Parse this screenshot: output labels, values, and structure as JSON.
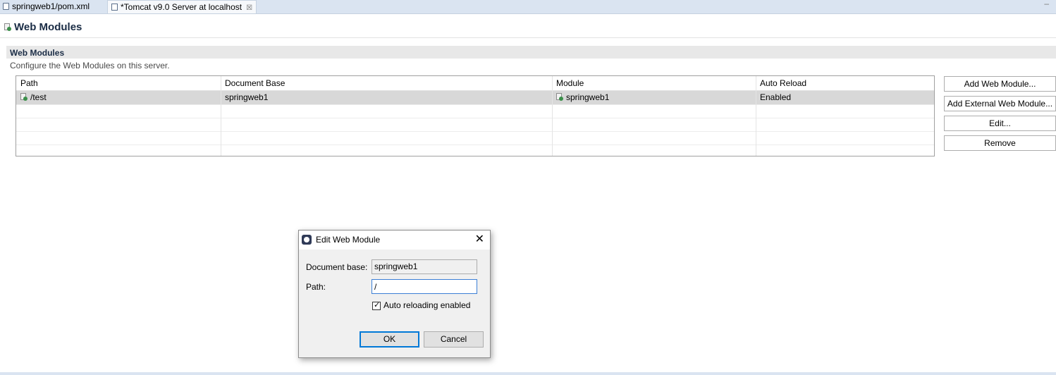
{
  "tabs": [
    {
      "label": "springweb1/pom.xml",
      "icon": "pom-file-icon"
    },
    {
      "label": "*Tomcat v9.0 Server at localhost",
      "icon": "server-icon",
      "close": "☒"
    }
  ],
  "minimize": "–",
  "page": {
    "title": "Web Modules"
  },
  "section": {
    "title": "Web Modules",
    "description": "Configure the Web Modules on this server."
  },
  "table": {
    "columns": [
      "Path",
      "Document Base",
      "Module",
      "Auto Reload"
    ],
    "rows": [
      [
        "/test",
        "springweb1",
        "springweb1",
        "Enabled"
      ]
    ]
  },
  "buttons": {
    "add": "Add Web Module...",
    "add_external": "Add External Web Module...",
    "edit": "Edit...",
    "remove": "Remove"
  },
  "dialog": {
    "title": "Edit Web Module",
    "close": "✕",
    "doc_base_label": "Document base:",
    "doc_base_value": "springweb1",
    "path_label": "Path:",
    "path_value": "/",
    "auto_reload_label": "Auto reloading enabled",
    "auto_reload_checked": true,
    "ok": "OK",
    "cancel": "Cancel"
  },
  "colors": {
    "tab_strip": "#dae4f1",
    "title_text": "#1a2c45",
    "selected_row": "#d8d8d8",
    "focus_border": "#0078d7"
  }
}
